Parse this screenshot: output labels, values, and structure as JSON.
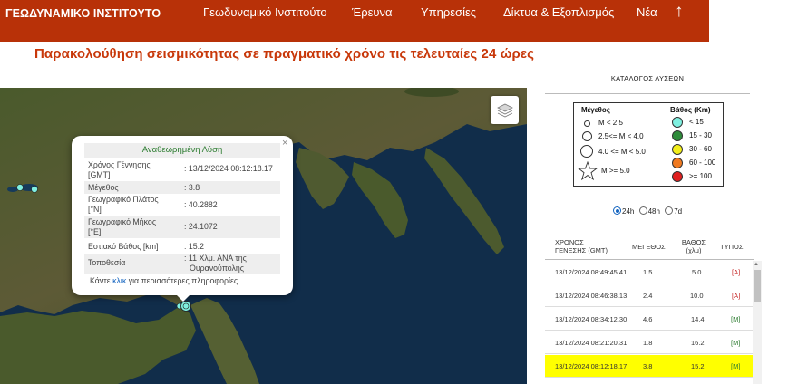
{
  "header": {
    "logo": "ΓΕΩΔΥΝΑΜΙΚΟ ΙΝΣΤΙΤΟΥΤΟ",
    "nav": [
      "Γεωδυναμικό Ινστιτούτο",
      "Έρευνα",
      "Υπηρεσίες",
      "Δίκτυα & Εξοπλισμός",
      "Νέα"
    ],
    "up_arrow": "↑"
  },
  "page_title": "Παρακολούθηση σεισμικότητας σε πραγματικό χρόνο τις τελευταίες 24 ώρες",
  "popup": {
    "close": "×",
    "title": "Αναθεωρημένη Λύση",
    "rows": [
      {
        "k1": "Χρόνος Γέννησης",
        "k2": "[GMT]",
        "v1": ": 13/12/2024 08:12:18.17",
        "v2": ""
      },
      {
        "k1": "Μέγεθος",
        "k2": "",
        "v1": ": 3.8",
        "v2": ""
      },
      {
        "k1": "Γεωγραφικό Πλάτος",
        "k2": "[°N]",
        "v1": ": 40.2882",
        "v2": ""
      },
      {
        "k1": "Γεωγραφικό Μήκος",
        "k2": "[°E]",
        "v1": ": 24.1072",
        "v2": ""
      },
      {
        "k1": "Εστιακό Βάθος [km]",
        "k2": "",
        "v1": ": 15.2",
        "v2": ""
      },
      {
        "k1": "Τοποθεσία",
        "k2": "",
        "v1": ": 11 Χλμ. ΑΝΑ της",
        "v2": "Ουρανούπολης"
      }
    ],
    "more_pre": "Κάντε ",
    "more_link": "κλικ",
    "more_post": " για περισσότερες πληροφορίες"
  },
  "catalog": {
    "title": "ΚΑΤΑΛΟΓΟΣ ΛΥΣΕΩΝ",
    "legend": {
      "mag_title": "Μέγεθος",
      "depth_title": "Βάθος (Km)",
      "mags": [
        "M < 2.5",
        "2.5<= M < 4.0",
        "4.0 <= M < 5.0",
        "M >= 5.0"
      ],
      "depths": [
        {
          "label": "< 15",
          "color": "#7ff0e0"
        },
        {
          "label": "15 - 30",
          "color": "#2e8b3a"
        },
        {
          "label": "30 - 60",
          "color": "#f2ee1a"
        },
        {
          "label": "60 - 100",
          "color": "#f07a20"
        },
        {
          "label": ">= 100",
          "color": "#e02020"
        }
      ]
    },
    "filters": [
      {
        "label": "24h",
        "checked": true
      },
      {
        "label": "48h",
        "checked": false
      },
      {
        "label": "7d",
        "checked": false
      }
    ],
    "columns": {
      "time1": "ΧΡΟΝΟΣ",
      "time2": "ΓΕΝΕΣΗΣ (GMT)",
      "mag": "ΜΕΓΕΘΟΣ",
      "depth1": "ΒΑΘΟΣ",
      "depth2": "(χλμ)",
      "type": "ΤΥΠΟΣ"
    },
    "rows": [
      {
        "time": "13/12/2024 08:49:45.41",
        "mag": "1.5",
        "depth": "5.0",
        "type": "[A]"
      },
      {
        "time": "13/12/2024 08:46:38.13",
        "mag": "2.4",
        "depth": "10.0",
        "type": "[A]"
      },
      {
        "time": "13/12/2024 08:34:12.30",
        "mag": "4.6",
        "depth": "14.4",
        "type": "[M]"
      },
      {
        "time": "13/12/2024 08:21:20.31",
        "mag": "1.8",
        "depth": "16.2",
        "type": "[M]"
      },
      {
        "time": "13/12/2024 08:12:18.17",
        "mag": "3.8",
        "depth": "15.2",
        "type": "[M]"
      }
    ],
    "highlight_row": 4
  },
  "colors": {
    "brand": "#b83108",
    "title": "#c8380a",
    "highlight": "#ffff00",
    "manual": "#2e7d32",
    "auto": "#c62828"
  }
}
